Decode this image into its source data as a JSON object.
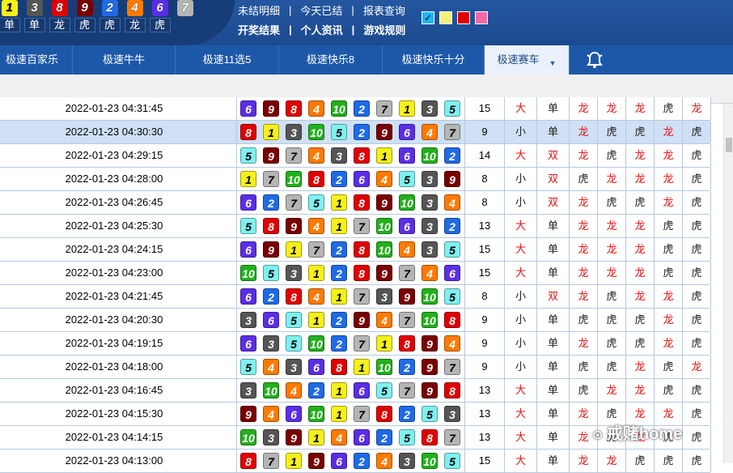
{
  "header": {
    "result_balls": [
      {
        "n": "1",
        "lab": "单",
        "bg": "#f6f01a",
        "fg": "#000"
      },
      {
        "n": "3",
        "lab": "单",
        "bg": "#555555",
        "fg": "#fff"
      },
      {
        "n": "8",
        "lab": "龙",
        "bg": "#e00000",
        "fg": "#fff"
      },
      {
        "n": "9",
        "lab": "虎",
        "bg": "#7a0000",
        "fg": "#fff"
      },
      {
        "n": "2",
        "lab": "虎",
        "bg": "#1f6ae6",
        "fg": "#fff"
      },
      {
        "n": "4",
        "lab": "龙",
        "bg": "#ff7a00",
        "fg": "#fff"
      },
      {
        "n": "6",
        "lab": "虎",
        "bg": "#5a2ee6",
        "fg": "#fff"
      },
      {
        "n": "7",
        "lab": "",
        "bg": "#b5b5b5",
        "fg": "#fff"
      }
    ],
    "links_row1": [
      "未结明细",
      "今天已结",
      "报表查询"
    ],
    "links_row2": [
      "开奖结果",
      "个人资讯",
      "游戏规则"
    ],
    "separator": "|",
    "swatch_colors": [
      "#1fb6ff",
      "#f5f07a",
      "#e00000",
      "#f06aa6"
    ],
    "swatch_check": "✓"
  },
  "nav": {
    "tabs": [
      "极速百家乐",
      "极速牛牛",
      "极速11选5",
      "极速快乐8",
      "极速快乐十分",
      "极速赛车"
    ],
    "active_tab": "极速赛车",
    "active_arrow": "▼"
  },
  "ball_colors": {
    "1": [
      "#f6f01a",
      "#000"
    ],
    "2": [
      "#1f6ae6",
      "#fff"
    ],
    "3": [
      "#555555",
      "#fff"
    ],
    "4": [
      "#ff7a00",
      "#fff"
    ],
    "5": [
      "#7ff0f0",
      "#000"
    ],
    "6": [
      "#5a2ee6",
      "#fff"
    ],
    "7": [
      "#b5b5b5",
      "#000"
    ],
    "8": [
      "#e00000",
      "#fff"
    ],
    "9": [
      "#7a0000",
      "#fff"
    ],
    "10": [
      "#22b01c",
      "#fff"
    ]
  },
  "rows": [
    {
      "t": "2022-01-23 04:31:45",
      "b": [
        6,
        9,
        8,
        4,
        10,
        2,
        7,
        1,
        3,
        5
      ],
      "s": "15",
      "bs": "大",
      "oe": "单",
      "lh": [
        "龙",
        "龙",
        "龙",
        "虎",
        "龙"
      ]
    },
    {
      "t": "2022-01-23 04:30:30",
      "b": [
        8,
        1,
        3,
        10,
        5,
        2,
        9,
        6,
        4,
        7
      ],
      "s": "9",
      "bs": "小",
      "oe": "单",
      "lh": [
        "龙",
        "虎",
        "虎",
        "龙",
        "虎"
      ],
      "sel": true
    },
    {
      "t": "2022-01-23 04:29:15",
      "b": [
        5,
        9,
        7,
        4,
        3,
        8,
        1,
        6,
        10,
        2
      ],
      "s": "14",
      "bs": "大",
      "oe": "双",
      "lh": [
        "龙",
        "虎",
        "龙",
        "龙",
        "虎"
      ]
    },
    {
      "t": "2022-01-23 04:28:00",
      "b": [
        1,
        7,
        10,
        8,
        2,
        6,
        4,
        5,
        3,
        9
      ],
      "s": "8",
      "bs": "小",
      "oe": "双",
      "lh": [
        "虎",
        "龙",
        "龙",
        "龙",
        "虎"
      ]
    },
    {
      "t": "2022-01-23 04:26:45",
      "b": [
        6,
        2,
        7,
        5,
        1,
        8,
        9,
        10,
        3,
        4
      ],
      "s": "8",
      "bs": "小",
      "oe": "双",
      "lh": [
        "龙",
        "虎",
        "虎",
        "龙",
        "虎"
      ]
    },
    {
      "t": "2022-01-23 04:25:30",
      "b": [
        5,
        8,
        9,
        4,
        1,
        7,
        10,
        6,
        3,
        2
      ],
      "s": "13",
      "bs": "大",
      "oe": "单",
      "lh": [
        "龙",
        "龙",
        "龙",
        "虎",
        "虎"
      ]
    },
    {
      "t": "2022-01-23 04:24:15",
      "b": [
        6,
        9,
        1,
        7,
        2,
        8,
        10,
        4,
        3,
        5
      ],
      "s": "15",
      "bs": "大",
      "oe": "单",
      "lh": [
        "龙",
        "龙",
        "龙",
        "虎",
        "虎"
      ]
    },
    {
      "t": "2022-01-23 04:23:00",
      "b": [
        10,
        5,
        3,
        1,
        2,
        8,
        9,
        7,
        4,
        6
      ],
      "s": "15",
      "bs": "大",
      "oe": "单",
      "lh": [
        "龙",
        "龙",
        "龙",
        "虎",
        "虎"
      ]
    },
    {
      "t": "2022-01-23 04:21:45",
      "b": [
        6,
        2,
        8,
        4,
        1,
        7,
        3,
        9,
        10,
        5
      ],
      "s": "8",
      "bs": "小",
      "oe": "双",
      "lh": [
        "龙",
        "虎",
        "龙",
        "龙",
        "虎"
      ]
    },
    {
      "t": "2022-01-23 04:20:30",
      "b": [
        3,
        6,
        5,
        1,
        2,
        9,
        4,
        7,
        10,
        8
      ],
      "s": "9",
      "bs": "小",
      "oe": "单",
      "lh": [
        "虎",
        "虎",
        "虎",
        "龙",
        "虎"
      ]
    },
    {
      "t": "2022-01-23 04:19:15",
      "b": [
        6,
        3,
        5,
        10,
        2,
        7,
        1,
        8,
        9,
        4
      ],
      "s": "9",
      "bs": "小",
      "oe": "单",
      "lh": [
        "龙",
        "虎",
        "虎",
        "龙",
        "虎"
      ]
    },
    {
      "t": "2022-01-23 04:18:00",
      "b": [
        5,
        4,
        3,
        6,
        8,
        1,
        10,
        2,
        9,
        7
      ],
      "s": "9",
      "bs": "小",
      "oe": "单",
      "lh": [
        "虎",
        "虎",
        "龙",
        "虎",
        "龙"
      ]
    },
    {
      "t": "2022-01-23 04:16:45",
      "b": [
        3,
        10,
        4,
        2,
        1,
        6,
        5,
        7,
        9,
        8
      ],
      "s": "13",
      "bs": "大",
      "oe": "单",
      "lh": [
        "虎",
        "龙",
        "龙",
        "虎",
        "虎"
      ]
    },
    {
      "t": "2022-01-23 04:15:30",
      "b": [
        9,
        4,
        6,
        10,
        1,
        7,
        8,
        2,
        5,
        3
      ],
      "s": "13",
      "bs": "大",
      "oe": "单",
      "lh": [
        "龙",
        "虎",
        "龙",
        "龙",
        "虎"
      ]
    },
    {
      "t": "2022-01-23 04:14:15",
      "b": [
        10,
        3,
        9,
        1,
        4,
        6,
        2,
        5,
        8,
        7
      ],
      "s": "13",
      "bs": "大",
      "oe": "单",
      "lh": [
        "龙",
        "虎",
        "龙",
        "虎",
        "虎"
      ]
    },
    {
      "t": "2022-01-23 04:13:00",
      "b": [
        8,
        7,
        1,
        9,
        6,
        2,
        4,
        3,
        10,
        5
      ],
      "s": "15",
      "bs": "大",
      "oe": "单",
      "lh": [
        "龙",
        "龙",
        "虎",
        "虎",
        "虎"
      ]
    }
  ],
  "watermark": "戒赌home"
}
